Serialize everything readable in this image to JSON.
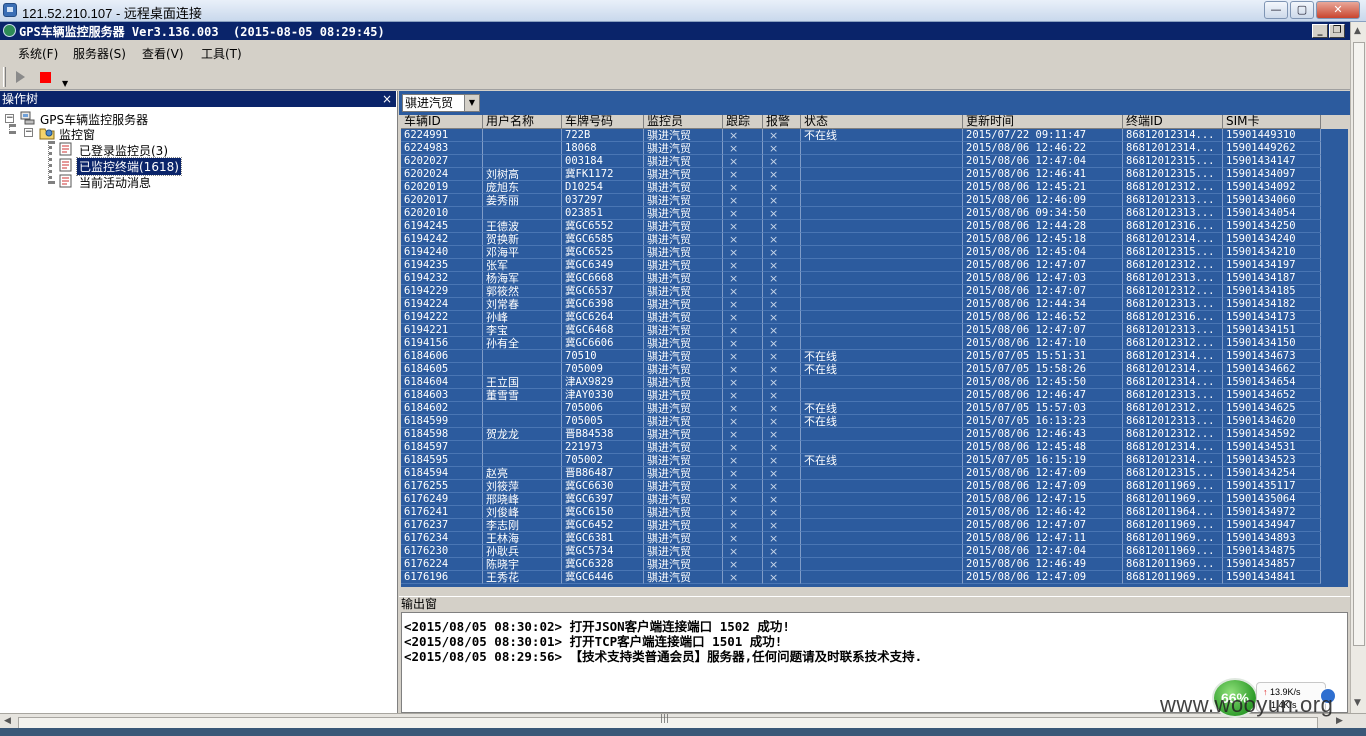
{
  "rdp": {
    "title": "121.52.210.107 - 远程桌面连接",
    "min_label": "—",
    "max_label": "▢",
    "close_label": "✕"
  },
  "app": {
    "title": "GPS车辆监控服务器 Ver3.136.003  (2015-08-05 08:29:45)",
    "min_label": "_",
    "restore_label": "❐",
    "close_label": "×"
  },
  "menu": [
    "系统(F)",
    "服务器(S)",
    "查看(V)",
    "工具(T)"
  ],
  "tree": {
    "header": "操作树",
    "close_label": "×",
    "root": "GPS车辆监控服务器",
    "monitor_window": "监控窗",
    "items": [
      "已登录监控员(3)",
      "已监控终端(1618)",
      "当前活动消息"
    ],
    "selected_index": 1
  },
  "filter": {
    "selected": "骐进汽贸"
  },
  "grid": {
    "columns": [
      "车辆ID",
      "用户名称",
      "车牌号码",
      "监控员",
      "跟踪",
      "报警",
      "状态",
      "更新时间",
      "终端ID",
      "SIM卡"
    ],
    "rows": [
      [
        "6224991",
        "",
        "722B",
        "骐进汽贸",
        "×",
        "×",
        "不在线",
        "2015/07/22 09:11:47",
        "86812012314...",
        "15901449310"
      ],
      [
        "6224983",
        "",
        "18068",
        "骐进汽贸",
        "×",
        "×",
        "",
        "2015/08/06 12:46:22",
        "86812012314...",
        "15901449262"
      ],
      [
        "6202027",
        "",
        "003184",
        "骐进汽贸",
        "×",
        "×",
        "",
        "2015/08/06 12:47:04",
        "86812012315...",
        "15901434147"
      ],
      [
        "6202024",
        "刘树高",
        "冀FK1172",
        "骐进汽贸",
        "×",
        "×",
        "",
        "2015/08/06 12:46:41",
        "86812012315...",
        "15901434097"
      ],
      [
        "6202019",
        "庞旭东",
        "D10254",
        "骐进汽贸",
        "×",
        "×",
        "",
        "2015/08/06 12:45:21",
        "86812012312...",
        "15901434092"
      ],
      [
        "6202017",
        "姜秀丽",
        "037297",
        "骐进汽贸",
        "×",
        "×",
        "",
        "2015/08/06 12:46:09",
        "86812012313...",
        "15901434060"
      ],
      [
        "6202010",
        "",
        "023851",
        "骐进汽贸",
        "×",
        "×",
        "",
        "2015/08/06 09:34:50",
        "86812012313...",
        "15901434054"
      ],
      [
        "6194245",
        "王德波",
        "冀GC6552",
        "骐进汽贸",
        "×",
        "×",
        "",
        "2015/08/06 12:44:28",
        "86812012316...",
        "15901434250"
      ],
      [
        "6194242",
        "贺换新",
        "冀GC6585",
        "骐进汽贸",
        "×",
        "×",
        "",
        "2015/08/06 12:45:18",
        "86812012314...",
        "15901434240"
      ],
      [
        "6194240",
        "邓海平",
        "冀GC6525",
        "骐进汽贸",
        "×",
        "×",
        "",
        "2015/08/06 12:45:04",
        "86812012315...",
        "15901434210"
      ],
      [
        "6194235",
        "张军",
        "冀GC6349",
        "骐进汽贸",
        "×",
        "×",
        "",
        "2015/08/06 12:47:07",
        "86812012312...",
        "15901434197"
      ],
      [
        "6194232",
        "杨海军",
        "冀GC6668",
        "骐进汽贸",
        "×",
        "×",
        "",
        "2015/08/06 12:47:03",
        "86812012313...",
        "15901434187"
      ],
      [
        "6194229",
        "郭筱然",
        "冀GC6537",
        "骐进汽贸",
        "×",
        "×",
        "",
        "2015/08/06 12:47:07",
        "86812012312...",
        "15901434185"
      ],
      [
        "6194224",
        "刘常春",
        "冀GC6398",
        "骐进汽贸",
        "×",
        "×",
        "",
        "2015/08/06 12:44:34",
        "86812012313...",
        "15901434182"
      ],
      [
        "6194222",
        "孙峰",
        "冀GC6264",
        "骐进汽贸",
        "×",
        "×",
        "",
        "2015/08/06 12:46:52",
        "86812012316...",
        "15901434173"
      ],
      [
        "6194221",
        "李宝",
        "冀GC6468",
        "骐进汽贸",
        "×",
        "×",
        "",
        "2015/08/06 12:47:07",
        "86812012313...",
        "15901434151"
      ],
      [
        "6194156",
        "孙有全",
        "冀GC6606",
        "骐进汽贸",
        "×",
        "×",
        "",
        "2015/08/06 12:47:10",
        "86812012312...",
        "15901434150"
      ],
      [
        "6184606",
        "",
        "70510",
        "骐进汽贸",
        "×",
        "×",
        "不在线",
        "2015/07/05 15:51:31",
        "86812012314...",
        "15901434673"
      ],
      [
        "6184605",
        "",
        "705009",
        "骐进汽贸",
        "×",
        "×",
        "不在线",
        "2015/07/05 15:58:26",
        "86812012314...",
        "15901434662"
      ],
      [
        "6184604",
        "王立国",
        "津AX9829",
        "骐进汽贸",
        "×",
        "×",
        "",
        "2015/08/06 12:45:50",
        "86812012314...",
        "15901434654"
      ],
      [
        "6184603",
        "董雪雪",
        "津AY0330",
        "骐进汽贸",
        "×",
        "×",
        "",
        "2015/08/06 12:46:47",
        "86812012313...",
        "15901434652"
      ],
      [
        "6184602",
        "",
        "705006",
        "骐进汽贸",
        "×",
        "×",
        "不在线",
        "2015/07/05 15:57:03",
        "86812012312...",
        "15901434625"
      ],
      [
        "6184599",
        "",
        "705005",
        "骐进汽贸",
        "×",
        "×",
        "不在线",
        "2015/07/05 16:13:23",
        "86812012313...",
        "15901434620"
      ],
      [
        "6184598",
        "贺龙龙",
        "晋B84538",
        "骐进汽贸",
        "×",
        "×",
        "",
        "2015/08/06 12:46:43",
        "86812012312...",
        "15901434592"
      ],
      [
        "6184597",
        "",
        "221973",
        "骐进汽贸",
        "×",
        "×",
        "",
        "2015/08/06 12:45:48",
        "86812012314...",
        "15901434531"
      ],
      [
        "6184595",
        "",
        "705002",
        "骐进汽贸",
        "×",
        "×",
        "不在线",
        "2015/07/05 16:15:19",
        "86812012314...",
        "15901434523"
      ],
      [
        "6184594",
        "赵亮",
        "晋B86487",
        "骐进汽贸",
        "×",
        "×",
        "",
        "2015/08/06 12:47:09",
        "86812012315...",
        "15901434254"
      ],
      [
        "6176255",
        "刘筱萍",
        "冀GC6630",
        "骐进汽贸",
        "×",
        "×",
        "",
        "2015/08/06 12:47:09",
        "86812011969...",
        "15901435117"
      ],
      [
        "6176249",
        "邢晓峰",
        "冀GC6397",
        "骐进汽贸",
        "×",
        "×",
        "",
        "2015/08/06 12:47:15",
        "86812011969...",
        "15901435064"
      ],
      [
        "6176241",
        "刘俊峰",
        "冀GC6150",
        "骐进汽贸",
        "×",
        "×",
        "",
        "2015/08/06 12:46:42",
        "86812011964...",
        "15901434972"
      ],
      [
        "6176237",
        "李志刚",
        "冀GC6452",
        "骐进汽贸",
        "×",
        "×",
        "",
        "2015/08/06 12:47:07",
        "86812011969...",
        "15901434947"
      ],
      [
        "6176234",
        "王林海",
        "冀GC6381",
        "骐进汽贸",
        "×",
        "×",
        "",
        "2015/08/06 12:47:11",
        "86812011969...",
        "15901434893"
      ],
      [
        "6176230",
        "孙耿兵",
        "冀GC5734",
        "骐进汽贸",
        "×",
        "×",
        "",
        "2015/08/06 12:47:04",
        "86812011969...",
        "15901434875"
      ],
      [
        "6176224",
        "陈晓宇",
        "冀GC6328",
        "骐进汽贸",
        "×",
        "×",
        "",
        "2015/08/06 12:46:49",
        "86812011969...",
        "15901434857"
      ],
      [
        "6176196",
        "王秀花",
        "冀GC6446",
        "骐进汽贸",
        "×",
        "×",
        "",
        "2015/08/06 12:47:09",
        "86812011969...",
        "15901434841"
      ]
    ]
  },
  "output": {
    "header": "输出窗",
    "lines": [
      "<2015/08/05 08:30:02> 打开JSON客户端连接端口 1502 成功!",
      "<2015/08/05 08:30:01> 打开TCP客户端连接端口 1501 成功!",
      "<2015/08/05 08:29:56> 【技术支持类普通会员】服务器,任何问题请及时联系技术支持."
    ]
  },
  "net_meter": {
    "percent": "66%",
    "up": "13.9K/s",
    "down": "1.4K/s"
  },
  "watermark": "www.wooyun.org",
  "icons": {
    "tree_root": "server-icon",
    "tree_folder": "folder-icon",
    "tree_item": "document-icon",
    "toolbar_start": "play-icon",
    "toolbar_stop": "stop-icon"
  }
}
